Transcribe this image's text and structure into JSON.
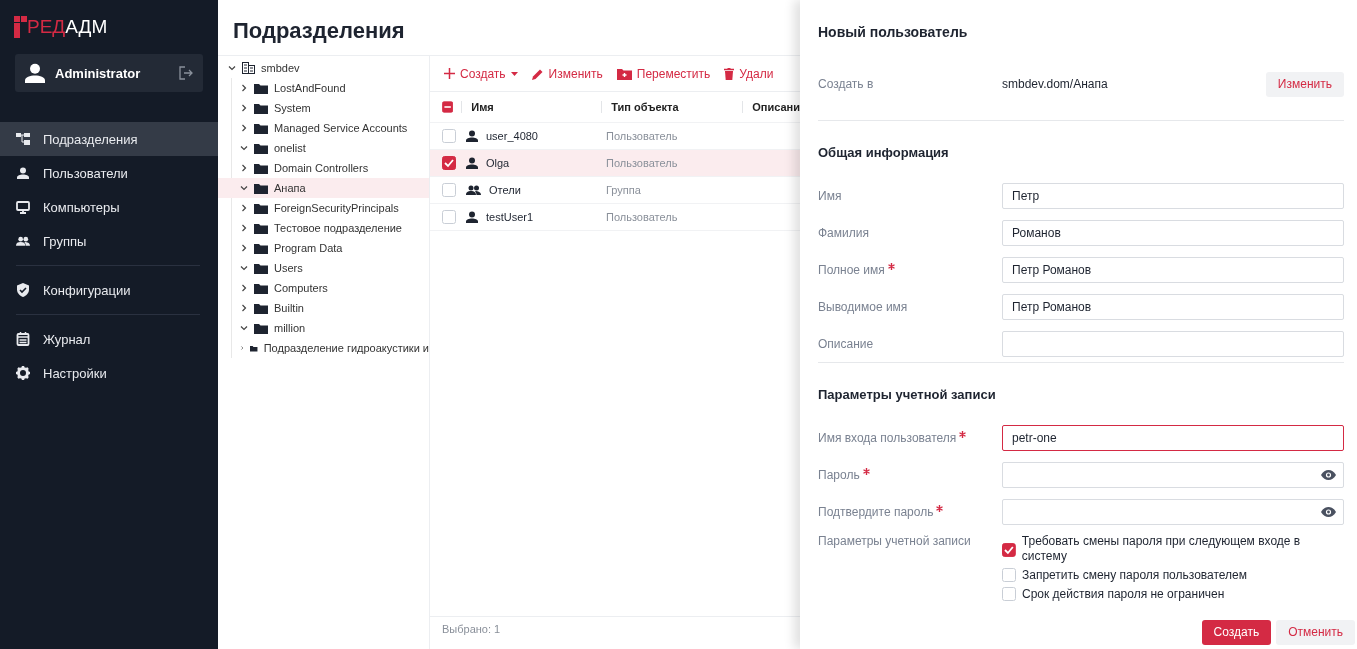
{
  "logo": {
    "accent": "РЕД",
    "text": "АДМ"
  },
  "user": {
    "name": "Administrator"
  },
  "nav": [
    {
      "label": "Подразделения",
      "selected": true,
      "divider_before": false
    },
    {
      "label": "Пользователи",
      "selected": false,
      "divider_before": false
    },
    {
      "label": "Компьютеры",
      "selected": false,
      "divider_before": false
    },
    {
      "label": "Группы",
      "selected": false,
      "divider_before": false
    },
    {
      "label": "Конфигурации",
      "selected": false,
      "divider_before": true
    },
    {
      "label": "Журнал",
      "selected": false,
      "divider_before": true
    },
    {
      "label": "Настройки",
      "selected": false,
      "divider_before": false
    }
  ],
  "page_title": "Подразделения",
  "tree": {
    "name": "smbdev",
    "expanded": true,
    "selected": false,
    "children": [
      {
        "name": "LostAndFound",
        "expanded": false,
        "selected": false
      },
      {
        "name": "System",
        "expanded": false,
        "selected": false
      },
      {
        "name": "Managed Service Accounts",
        "expanded": false,
        "selected": false
      },
      {
        "name": "onelist",
        "expanded": true,
        "selected": false
      },
      {
        "name": "Domain Controllers",
        "expanded": false,
        "selected": false
      },
      {
        "name": "Анапа",
        "expanded": true,
        "selected": true
      },
      {
        "name": "ForeignSecurityPrincipals",
        "expanded": false,
        "selected": false
      },
      {
        "name": "Тестовое подразделение",
        "expanded": false,
        "selected": false
      },
      {
        "name": "Program Data",
        "expanded": false,
        "selected": false
      },
      {
        "name": "Users",
        "expanded": true,
        "selected": false
      },
      {
        "name": "Computers",
        "expanded": false,
        "selected": false
      },
      {
        "name": "Builtin",
        "expanded": false,
        "selected": false
      },
      {
        "name": "million",
        "expanded": true,
        "selected": false
      },
      {
        "name": "Подразделение гидроакустики и",
        "expanded": false,
        "selected": false
      }
    ]
  },
  "toolbar": [
    {
      "label": "Создать",
      "dropdown": true
    },
    {
      "label": "Изменить",
      "dropdown": false
    },
    {
      "label": "Переместить",
      "dropdown": false
    },
    {
      "label": "Удали",
      "dropdown": false
    }
  ],
  "table": {
    "select_all_indeterminate": true,
    "columns": [
      "Имя",
      "Тип объекта",
      "Описани"
    ],
    "rows": [
      {
        "name": "user_4080",
        "type": "Пользователь",
        "kind": "user",
        "selected": false
      },
      {
        "name": "Olga",
        "type": "Пользователь",
        "kind": "user",
        "selected": true
      },
      {
        "name": "Отели",
        "type": "Группа",
        "kind": "group",
        "selected": false
      },
      {
        "name": "testUser1",
        "type": "Пользователь",
        "kind": "user",
        "selected": false
      }
    ]
  },
  "status": "Выбрано: 1",
  "form": {
    "title": "Новый пользователь",
    "location": {
      "label": "Создать в",
      "value": "smbdev.dom/Анапа",
      "button": "Изменить"
    },
    "sections": [
      {
        "title": "Общая информация",
        "fields": [
          {
            "label": "Имя",
            "required": false,
            "kind": "text",
            "value": "Петр",
            "invalid": false
          },
          {
            "label": "Фамилия",
            "required": false,
            "kind": "text",
            "value": "Романов",
            "invalid": false
          },
          {
            "label": "Полное имя",
            "required": true,
            "kind": "text",
            "value": "Петр Романов",
            "invalid": false
          },
          {
            "label": "Выводимое имя",
            "required": false,
            "kind": "text",
            "value": "Петр Романов",
            "invalid": false
          },
          {
            "label": "Описание",
            "required": false,
            "kind": "text",
            "invalid": false
          }
        ]
      },
      {
        "title": "Параметры учетной записи",
        "fields": [
          {
            "label": "Имя входа пользователя",
            "required": true,
            "kind": "text",
            "value": "petr-one",
            "invalid": true
          },
          {
            "label": "Пароль",
            "required": true,
            "kind": "password",
            "invalid": false
          },
          {
            "label": "Подтвердите пароль",
            "required": true,
            "kind": "password",
            "invalid": false
          }
        ],
        "options_label": "Параметры учетной записи",
        "options": [
          {
            "label": "Требовать смены пароля при следующем входе в систему",
            "checked": true
          },
          {
            "label": "Запретить смену пароля пользователем",
            "checked": false
          },
          {
            "label": "Срок действия пароля не ограничен",
            "checked": false
          }
        ]
      }
    ],
    "buttons": [
      {
        "label": "Создать",
        "primary": true
      },
      {
        "label": "Отменить",
        "primary": false
      }
    ]
  }
}
